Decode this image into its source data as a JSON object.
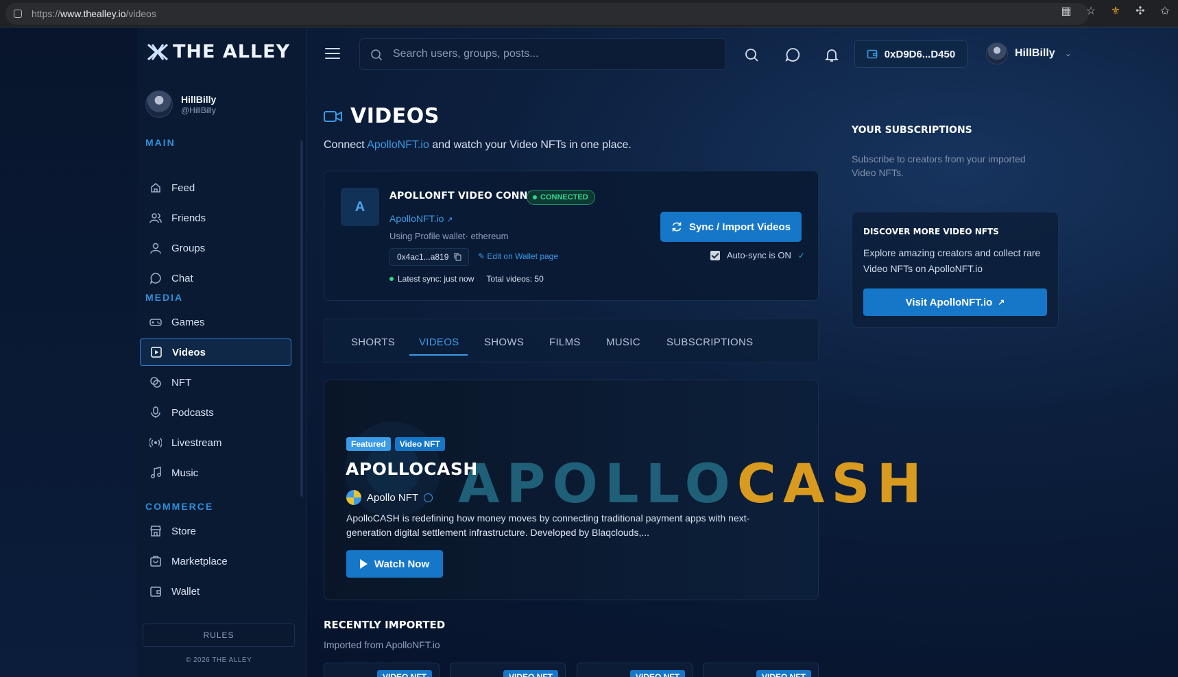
{
  "browser": {
    "url_prefix": "https://",
    "url_host": "www.thealley.io",
    "url_path": "/videos"
  },
  "brand": {
    "logo_text": "THE ALLEY"
  },
  "profile": {
    "name": "HillBilly",
    "handle": "@HillBilly"
  },
  "sidebar": {
    "main_label": "MAIN",
    "main_items": [
      {
        "label": "Feed",
        "icon": "home-icon"
      },
      {
        "label": "Friends",
        "icon": "friends-icon"
      },
      {
        "label": "Groups",
        "icon": "groups-icon"
      },
      {
        "label": "Chat",
        "icon": "chat-icon"
      }
    ],
    "media_label": "MEDIA",
    "media_items": [
      {
        "label": "Games",
        "icon": "gamepad-icon"
      },
      {
        "label": "Videos",
        "icon": "video-icon",
        "active": true
      },
      {
        "label": "NFT",
        "icon": "nft-icon"
      },
      {
        "label": "Podcasts",
        "icon": "microphone-icon"
      },
      {
        "label": "Livestream",
        "icon": "broadcast-icon"
      },
      {
        "label": "Music",
        "icon": "music-icon"
      }
    ],
    "commerce_label": "COMMERCE",
    "commerce_items": [
      {
        "label": "Store",
        "icon": "store-icon"
      },
      {
        "label": "Marketplace",
        "icon": "marketplace-icon"
      },
      {
        "label": "Wallet",
        "icon": "wallet-icon"
      }
    ],
    "rules_label": "RULES",
    "copyright": "© 2026 THE ALLEY"
  },
  "header": {
    "search_placeholder": "Search users, groups, posts...",
    "wallet_address": "0xD9D6...D450",
    "username": "HillBilly"
  },
  "page": {
    "title": "VIDEOS",
    "subtitle_before": "Connect ",
    "subtitle_link": "ApolloNFT.io",
    "subtitle_after": " and watch your Video NFTs in one place."
  },
  "connection": {
    "avatar_letter": "A",
    "title": "APOLLONFT VIDEO CONNECTION",
    "status": "CONNECTED",
    "link": "ApolloNFT.io",
    "wallet_note": "Using Profile wallet· ethereum",
    "address": "0x4ac1...a819",
    "edit_link": "Edit on Wallet page",
    "latest_sync": "Latest sync: just now",
    "total_videos": "Total videos: 50",
    "sync_button": "Sync / Import Videos",
    "autosync_label": "Auto-sync is ON",
    "autosync_on": true
  },
  "tabs": [
    "SHORTS",
    "VIDEOS",
    "SHOWS",
    "FILMS",
    "MUSIC",
    "SUBSCRIPTIONS"
  ],
  "active_tab": "VIDEOS",
  "featured": {
    "badge_featured": "Featured",
    "badge_type": "Video NFT",
    "title": "APOLLOCASH",
    "banner_part1": "APOLLO",
    "banner_part2": "CASH",
    "creator": "Apollo NFT",
    "description": "ApolloCASH is redefining how money moves by connecting traditional payment apps with next-generation digital settlement infrastructure. Developed by Blaqclouds,...",
    "watch_button": "Watch Now"
  },
  "recent": {
    "title": "RECENTLY IMPORTED",
    "subtitle": "Imported from ApolloNFT.io",
    "card_badges": [
      "VIDEO NFT",
      "VIDEO NFT",
      "VIDEO NFT",
      "VIDEO NFT"
    ]
  },
  "right": {
    "subs_title": "YOUR SUBSCRIPTIONS",
    "subs_desc": "Subscribe to creators from your imported Video NFTs.",
    "discover_title": "DISCOVER MORE VIDEO NFTS",
    "discover_desc": "Explore amazing creators and collect rare Video NFTs on ApolloNFT.io",
    "visit_button": "Visit ApolloNFT.io"
  },
  "colors": {
    "accent": "#1677c9",
    "accent_light": "#3a9be6",
    "section_label": "#2f8fd8",
    "connected_green": "#33d68f",
    "banner_gold": "#d89a1f"
  }
}
